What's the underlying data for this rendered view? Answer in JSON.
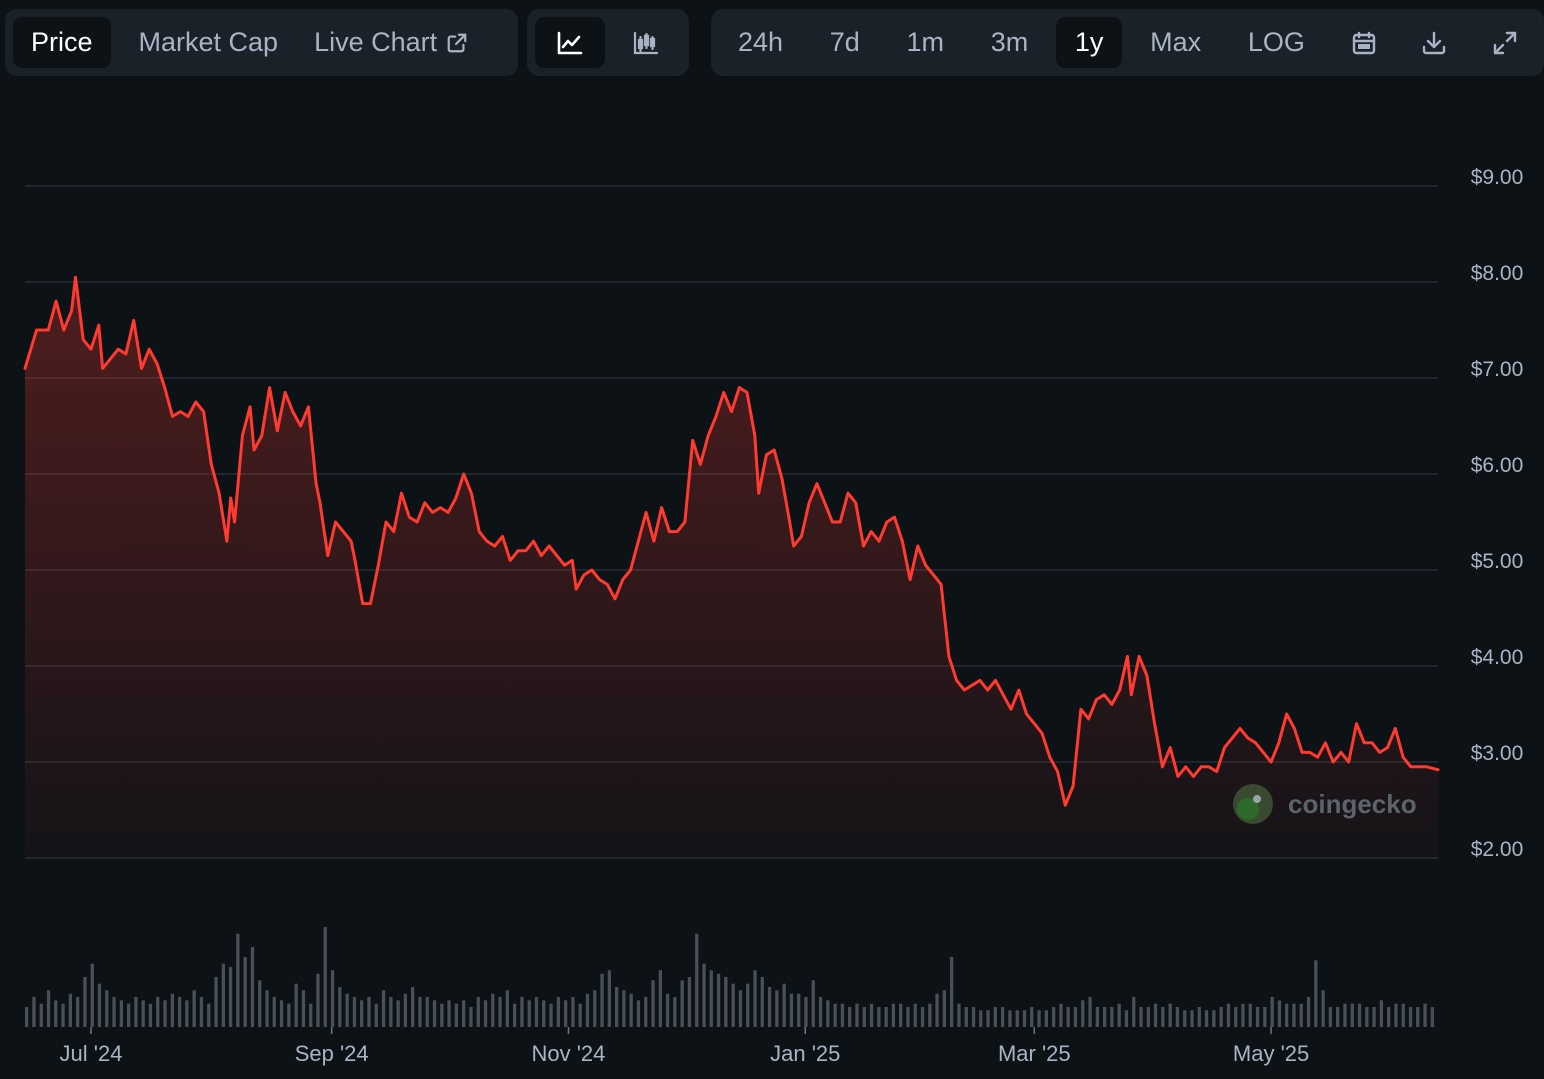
{
  "toolbar": {
    "metric_tabs": [
      {
        "label": "Price",
        "active": true
      },
      {
        "label": "Market Cap",
        "active": false
      },
      {
        "label": "Live Chart",
        "active": false,
        "icon": "external-link-icon"
      }
    ],
    "chart_types": [
      {
        "icon": "line-chart-icon",
        "active": true
      },
      {
        "icon": "candlestick-chart-icon",
        "active": false
      }
    ],
    "ranges": [
      {
        "label": "24h",
        "active": false
      },
      {
        "label": "7d",
        "active": false
      },
      {
        "label": "1m",
        "active": false
      },
      {
        "label": "3m",
        "active": false
      },
      {
        "label": "1y",
        "active": true
      },
      {
        "label": "Max",
        "active": false
      },
      {
        "label": "LOG",
        "active": false
      }
    ],
    "tool_icons": [
      "calendar-icon",
      "download-icon",
      "fullscreen-icon"
    ]
  },
  "watermark": {
    "text": "coingecko"
  },
  "colors": {
    "line": "#ff3b30",
    "grid": "#262d35",
    "background": "#0d1217",
    "volume": "#4a5058"
  },
  "chart_data": {
    "type": "line",
    "title": "",
    "xlabel": "",
    "ylabel": "",
    "ylim": [
      2,
      9.5
    ],
    "y_ticks": [
      9,
      8,
      7,
      6,
      5,
      4,
      3,
      2
    ],
    "y_tick_labels": [
      "$9.00",
      "$8.00",
      "$7.00",
      "$6.00",
      "$5.00",
      "$4.00",
      "$3.00",
      "$2.00"
    ],
    "x_range": [
      "2024-06-14",
      "2025-06-13"
    ],
    "x_ticks": [
      {
        "label": "Jul '24",
        "date": "2024-07-01"
      },
      {
        "label": "Sep '24",
        "date": "2024-09-01"
      },
      {
        "label": "Nov '24",
        "date": "2024-11-01"
      },
      {
        "label": "Jan '25",
        "date": "2025-01-01"
      },
      {
        "label": "Mar '25",
        "date": "2025-03-01"
      },
      {
        "label": "May '25",
        "date": "2025-05-01"
      }
    ],
    "grid": true,
    "legend": "none",
    "series": [
      {
        "points": [
          [
            "2024-06-14",
            7.1
          ],
          [
            "2024-06-17",
            7.5
          ],
          [
            "2024-06-20",
            7.5
          ],
          [
            "2024-06-22",
            7.8
          ],
          [
            "2024-06-24",
            7.5
          ],
          [
            "2024-06-26",
            7.7
          ],
          [
            "2024-06-27",
            8.05
          ],
          [
            "2024-06-29",
            7.4
          ],
          [
            "2024-07-01",
            7.3
          ],
          [
            "2024-07-03",
            7.55
          ],
          [
            "2024-07-04",
            7.1
          ],
          [
            "2024-07-06",
            7.2
          ],
          [
            "2024-07-08",
            7.3
          ],
          [
            "2024-07-10",
            7.25
          ],
          [
            "2024-07-12",
            7.6
          ],
          [
            "2024-07-14",
            7.1
          ],
          [
            "2024-07-16",
            7.3
          ],
          [
            "2024-07-18",
            7.15
          ],
          [
            "2024-07-20",
            6.9
          ],
          [
            "2024-07-22",
            6.6
          ],
          [
            "2024-07-24",
            6.65
          ],
          [
            "2024-07-26",
            6.6
          ],
          [
            "2024-07-28",
            6.75
          ],
          [
            "2024-07-30",
            6.65
          ],
          [
            "2024-08-01",
            6.1
          ],
          [
            "2024-08-03",
            5.8
          ],
          [
            "2024-08-05",
            5.3
          ],
          [
            "2024-08-06",
            5.75
          ],
          [
            "2024-08-07",
            5.5
          ],
          [
            "2024-08-09",
            6.4
          ],
          [
            "2024-08-11",
            6.7
          ],
          [
            "2024-08-12",
            6.25
          ],
          [
            "2024-08-14",
            6.4
          ],
          [
            "2024-08-16",
            6.9
          ],
          [
            "2024-08-18",
            6.45
          ],
          [
            "2024-08-20",
            6.85
          ],
          [
            "2024-08-22",
            6.65
          ],
          [
            "2024-08-24",
            6.5
          ],
          [
            "2024-08-26",
            6.7
          ],
          [
            "2024-08-28",
            5.9
          ],
          [
            "2024-08-29",
            5.7
          ],
          [
            "2024-08-31",
            5.15
          ],
          [
            "2024-09-02",
            5.5
          ],
          [
            "2024-09-04",
            5.4
          ],
          [
            "2024-09-06",
            5.3
          ],
          [
            "2024-09-07",
            5.1
          ],
          [
            "2024-09-09",
            4.65
          ],
          [
            "2024-09-11",
            4.65
          ],
          [
            "2024-09-13",
            5.05
          ],
          [
            "2024-09-15",
            5.5
          ],
          [
            "2024-09-17",
            5.4
          ],
          [
            "2024-09-19",
            5.8
          ],
          [
            "2024-09-21",
            5.55
          ],
          [
            "2024-09-23",
            5.5
          ],
          [
            "2024-09-25",
            5.7
          ],
          [
            "2024-09-27",
            5.6
          ],
          [
            "2024-09-29",
            5.65
          ],
          [
            "2024-10-01",
            5.6
          ],
          [
            "2024-10-03",
            5.75
          ],
          [
            "2024-10-05",
            6.0
          ],
          [
            "2024-10-07",
            5.8
          ],
          [
            "2024-10-09",
            5.4
          ],
          [
            "2024-10-11",
            5.3
          ],
          [
            "2024-10-13",
            5.25
          ],
          [
            "2024-10-15",
            5.35
          ],
          [
            "2024-10-17",
            5.1
          ],
          [
            "2024-10-19",
            5.2
          ],
          [
            "2024-10-21",
            5.2
          ],
          [
            "2024-10-23",
            5.3
          ],
          [
            "2024-10-25",
            5.15
          ],
          [
            "2024-10-27",
            5.25
          ],
          [
            "2024-10-29",
            5.15
          ],
          [
            "2024-10-31",
            5.05
          ],
          [
            "2024-11-02",
            5.1
          ],
          [
            "2024-11-03",
            4.8
          ],
          [
            "2024-11-05",
            4.95
          ],
          [
            "2024-11-07",
            5.0
          ],
          [
            "2024-11-09",
            4.9
          ],
          [
            "2024-11-11",
            4.85
          ],
          [
            "2024-11-13",
            4.7
          ],
          [
            "2024-11-15",
            4.9
          ],
          [
            "2024-11-17",
            5.0
          ],
          [
            "2024-11-19",
            5.3
          ],
          [
            "2024-11-21",
            5.6
          ],
          [
            "2024-11-23",
            5.3
          ],
          [
            "2024-11-25",
            5.65
          ],
          [
            "2024-11-27",
            5.4
          ],
          [
            "2024-11-29",
            5.4
          ],
          [
            "2024-12-01",
            5.5
          ],
          [
            "2024-12-03",
            6.35
          ],
          [
            "2024-12-05",
            6.1
          ],
          [
            "2024-12-07",
            6.4
          ],
          [
            "2024-12-09",
            6.6
          ],
          [
            "2024-12-11",
            6.85
          ],
          [
            "2024-12-13",
            6.65
          ],
          [
            "2024-12-15",
            6.9
          ],
          [
            "2024-12-17",
            6.85
          ],
          [
            "2024-12-19",
            6.4
          ],
          [
            "2024-12-20",
            5.8
          ],
          [
            "2024-12-22",
            6.2
          ],
          [
            "2024-12-24",
            6.25
          ],
          [
            "2024-12-26",
            5.95
          ],
          [
            "2024-12-28",
            5.5
          ],
          [
            "2024-12-29",
            5.25
          ],
          [
            "2024-12-31",
            5.35
          ],
          [
            "2025-01-02",
            5.7
          ],
          [
            "2025-01-04",
            5.9
          ],
          [
            "2025-01-06",
            5.7
          ],
          [
            "2025-01-08",
            5.5
          ],
          [
            "2025-01-10",
            5.5
          ],
          [
            "2025-01-12",
            5.8
          ],
          [
            "2025-01-14",
            5.7
          ],
          [
            "2025-01-16",
            5.25
          ],
          [
            "2025-01-18",
            5.4
          ],
          [
            "2025-01-20",
            5.3
          ],
          [
            "2025-01-22",
            5.5
          ],
          [
            "2025-01-24",
            5.55
          ],
          [
            "2025-01-26",
            5.3
          ],
          [
            "2025-01-28",
            4.9
          ],
          [
            "2025-01-30",
            5.25
          ],
          [
            "2025-02-01",
            5.05
          ],
          [
            "2025-02-03",
            4.95
          ],
          [
            "2025-02-05",
            4.85
          ],
          [
            "2025-02-07",
            4.1
          ],
          [
            "2025-02-09",
            3.85
          ],
          [
            "2025-02-11",
            3.75
          ],
          [
            "2025-02-13",
            3.8
          ],
          [
            "2025-02-15",
            3.85
          ],
          [
            "2025-02-17",
            3.75
          ],
          [
            "2025-02-19",
            3.85
          ],
          [
            "2025-02-21",
            3.7
          ],
          [
            "2025-02-23",
            3.55
          ],
          [
            "2025-02-25",
            3.75
          ],
          [
            "2025-02-27",
            3.5
          ],
          [
            "2025-03-01",
            3.4
          ],
          [
            "2025-03-03",
            3.3
          ],
          [
            "2025-03-05",
            3.05
          ],
          [
            "2025-03-07",
            2.9
          ],
          [
            "2025-03-09",
            2.55
          ],
          [
            "2025-03-11",
            2.75
          ],
          [
            "2025-03-13",
            3.55
          ],
          [
            "2025-03-15",
            3.45
          ],
          [
            "2025-03-17",
            3.65
          ],
          [
            "2025-03-19",
            3.7
          ],
          [
            "2025-03-21",
            3.6
          ],
          [
            "2025-03-23",
            3.75
          ],
          [
            "2025-03-25",
            4.1
          ],
          [
            "2025-03-26",
            3.7
          ],
          [
            "2025-03-28",
            4.1
          ],
          [
            "2025-03-30",
            3.9
          ],
          [
            "2025-04-01",
            3.4
          ],
          [
            "2025-04-03",
            2.95
          ],
          [
            "2025-04-05",
            3.15
          ],
          [
            "2025-04-07",
            2.85
          ],
          [
            "2025-04-09",
            2.95
          ],
          [
            "2025-04-11",
            2.85
          ],
          [
            "2025-04-13",
            2.95
          ],
          [
            "2025-04-15",
            2.95
          ],
          [
            "2025-04-17",
            2.9
          ],
          [
            "2025-04-19",
            3.15
          ],
          [
            "2025-04-21",
            3.25
          ],
          [
            "2025-04-23",
            3.35
          ],
          [
            "2025-04-25",
            3.25
          ],
          [
            "2025-04-27",
            3.2
          ],
          [
            "2025-04-29",
            3.1
          ],
          [
            "2025-05-01",
            3.0
          ],
          [
            "2025-05-03",
            3.2
          ],
          [
            "2025-05-05",
            3.5
          ],
          [
            "2025-05-07",
            3.35
          ],
          [
            "2025-05-09",
            3.1
          ],
          [
            "2025-05-11",
            3.1
          ],
          [
            "2025-05-13",
            3.05
          ],
          [
            "2025-05-15",
            3.2
          ],
          [
            "2025-05-17",
            3.0
          ],
          [
            "2025-05-19",
            3.1
          ],
          [
            "2025-05-21",
            3.0
          ],
          [
            "2025-05-23",
            3.4
          ],
          [
            "2025-05-25",
            3.2
          ],
          [
            "2025-05-27",
            3.2
          ],
          [
            "2025-05-29",
            3.1
          ],
          [
            "2025-05-31",
            3.15
          ],
          [
            "2025-06-02",
            3.35
          ],
          [
            "2025-06-04",
            3.05
          ],
          [
            "2025-06-06",
            2.95
          ],
          [
            "2025-06-08",
            2.95
          ],
          [
            "2025-06-10",
            2.95
          ],
          [
            "2025-06-13",
            2.92
          ]
        ]
      }
    ],
    "volume": {
      "values": [
        12,
        18,
        14,
        22,
        16,
        14,
        20,
        18,
        30,
        38,
        26,
        22,
        18,
        16,
        14,
        18,
        16,
        14,
        18,
        16,
        20,
        18,
        16,
        22,
        18,
        14,
        30,
        38,
        36,
        56,
        42,
        48,
        28,
        22,
        18,
        16,
        14,
        26,
        22,
        14,
        32,
        60,
        34,
        24,
        20,
        18,
        16,
        18,
        14,
        22,
        18,
        16,
        20,
        24,
        18,
        18,
        16,
        14,
        16,
        14,
        16,
        12,
        18,
        16,
        20,
        18,
        22,
        14,
        18,
        16,
        18,
        16,
        14,
        18,
        16,
        18,
        14,
        20,
        22,
        32,
        34,
        24,
        22,
        20,
        16,
        18,
        28,
        34,
        20,
        18,
        28,
        30,
        56,
        38,
        34,
        32,
        30,
        26,
        22,
        26,
        34,
        30,
        24,
        22,
        26,
        20,
        20,
        18,
        28,
        18,
        16,
        14,
        14,
        12,
        14,
        12,
        14,
        12,
        12,
        14,
        14,
        12,
        14,
        12,
        14,
        20,
        22,
        42,
        14,
        12,
        12,
        10,
        10,
        12,
        12,
        10,
        10,
        10,
        12,
        10,
        10,
        12,
        14,
        12,
        12,
        16,
        18,
        12,
        12,
        12,
        14,
        10,
        18,
        12,
        12,
        14,
        12,
        14,
        12,
        10,
        10,
        12,
        10,
        10,
        12,
        14,
        12,
        14,
        14,
        12,
        12,
        18,
        16,
        14,
        14,
        14,
        18,
        40,
        22,
        12,
        12,
        14,
        14,
        14,
        12,
        12,
        16,
        12,
        14,
        14,
        12,
        12,
        14,
        12
      ]
    }
  }
}
